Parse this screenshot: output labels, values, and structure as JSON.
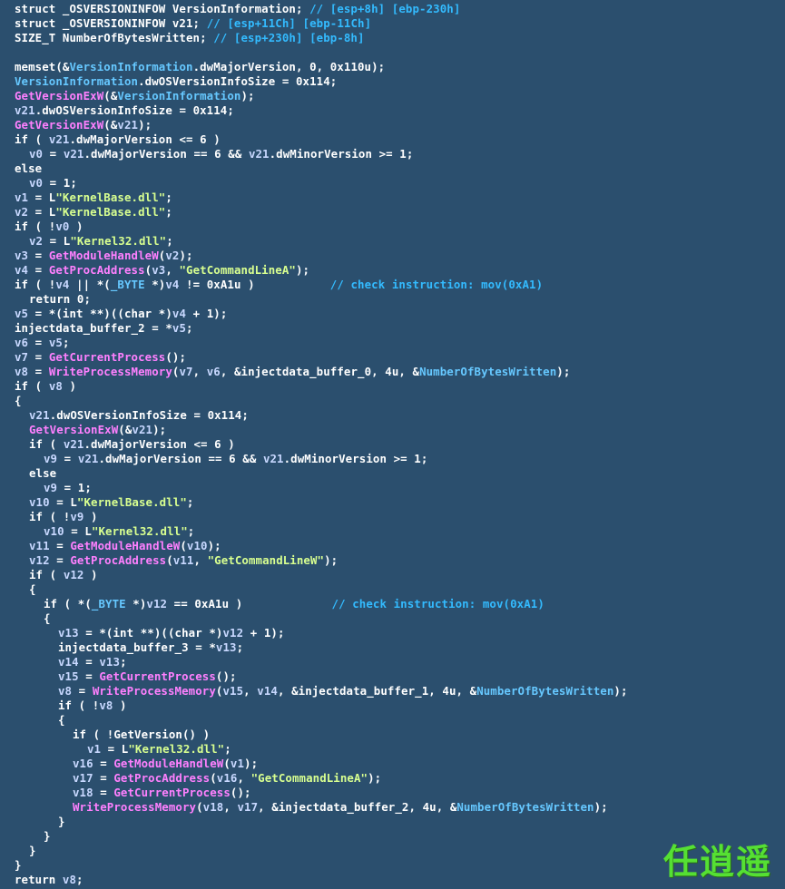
{
  "colors": {
    "background": "#2b4f6e",
    "default": "#ffffff",
    "comment": "#33bbff",
    "local_variable": "#c8d8ff",
    "global_variable": "#66c8ff",
    "function": "#ff80ff",
    "string": "#d8ff90",
    "watermark": "#55e033"
  },
  "code_lines": [
    {
      "indent": 0,
      "tokens": [
        [
          "struct _OSVERSIONINFOW VersionInformation; ",
          "d"
        ],
        [
          "// [esp+8h] [ebp-230h]",
          "c"
        ]
      ]
    },
    {
      "indent": 0,
      "tokens": [
        [
          "struct _OSVERSIONINFOW v21; ",
          "d"
        ],
        [
          "// [esp+11Ch] [ebp-11Ch]",
          "c"
        ]
      ]
    },
    {
      "indent": 0,
      "tokens": [
        [
          "SIZE_T NumberOfBytesWritten; ",
          "d"
        ],
        [
          "// [esp+230h] [ebp-8h]",
          "c"
        ]
      ]
    },
    {
      "indent": 0,
      "tokens": []
    },
    {
      "indent": 0,
      "tokens": [
        [
          "memset(&",
          "d"
        ],
        [
          "VersionInformation",
          "g"
        ],
        [
          ".dwMajorVersion, 0, 0x110u);",
          "d"
        ]
      ]
    },
    {
      "indent": 0,
      "tokens": [
        [
          "VersionInformation",
          "g"
        ],
        [
          ".dwOSVersionInfoSize = 0x114;",
          "d"
        ]
      ]
    },
    {
      "indent": 0,
      "tokens": [
        [
          "GetVersionExW",
          "f"
        ],
        [
          "(&",
          "d"
        ],
        [
          "VersionInformation",
          "g"
        ],
        [
          ");",
          "d"
        ]
      ]
    },
    {
      "indent": 0,
      "tokens": [
        [
          "v21",
          "v"
        ],
        [
          ".dwOSVersionInfoSize = 0x114;",
          "d"
        ]
      ]
    },
    {
      "indent": 0,
      "tokens": [
        [
          "GetVersionExW",
          "f"
        ],
        [
          "(&",
          "d"
        ],
        [
          "v21",
          "v"
        ],
        [
          ");",
          "d"
        ]
      ]
    },
    {
      "indent": 0,
      "tokens": [
        [
          "if ( ",
          "d"
        ],
        [
          "v21",
          "v"
        ],
        [
          ".dwMajorVersion <= 6 )",
          "d"
        ]
      ]
    },
    {
      "indent": 2,
      "tokens": [
        [
          "v0",
          "v"
        ],
        [
          " = ",
          "d"
        ],
        [
          "v21",
          "v"
        ],
        [
          ".dwMajorVersion == 6 && ",
          "d"
        ],
        [
          "v21",
          "v"
        ],
        [
          ".dwMinorVersion >= 1;",
          "d"
        ]
      ]
    },
    {
      "indent": 0,
      "tokens": [
        [
          "else",
          "d"
        ]
      ]
    },
    {
      "indent": 2,
      "tokens": [
        [
          "v0",
          "v"
        ],
        [
          " = 1;",
          "d"
        ]
      ]
    },
    {
      "indent": 0,
      "tokens": [
        [
          "v1",
          "v"
        ],
        [
          " = L",
          "d"
        ],
        [
          "\"KernelBase.dll\"",
          "s"
        ],
        [
          ";",
          "d"
        ]
      ]
    },
    {
      "indent": 0,
      "tokens": [
        [
          "v2",
          "v"
        ],
        [
          " = L",
          "d"
        ],
        [
          "\"KernelBase.dll\"",
          "s"
        ],
        [
          ";",
          "d"
        ]
      ]
    },
    {
      "indent": 0,
      "tokens": [
        [
          "if ( !",
          "d"
        ],
        [
          "v0",
          "v"
        ],
        [
          " )",
          "d"
        ]
      ]
    },
    {
      "indent": 2,
      "tokens": [
        [
          "v2",
          "v"
        ],
        [
          " = L",
          "d"
        ],
        [
          "\"Kernel32.dll\"",
          "s"
        ],
        [
          ";",
          "d"
        ]
      ]
    },
    {
      "indent": 0,
      "tokens": [
        [
          "v3",
          "v"
        ],
        [
          " = ",
          "d"
        ],
        [
          "GetModuleHandleW",
          "f"
        ],
        [
          "(",
          "d"
        ],
        [
          "v2",
          "v"
        ],
        [
          ");",
          "d"
        ]
      ]
    },
    {
      "indent": 0,
      "tokens": [
        [
          "v4",
          "v"
        ],
        [
          " = ",
          "d"
        ],
        [
          "GetProcAddress",
          "f"
        ],
        [
          "(",
          "d"
        ],
        [
          "v3",
          "v"
        ],
        [
          ", ",
          "d"
        ],
        [
          "\"GetCommandLineA\"",
          "s"
        ],
        [
          ");",
          "d"
        ]
      ]
    },
    {
      "indent": 0,
      "tokens": [
        [
          "if ( !",
          "d"
        ],
        [
          "v4",
          "v"
        ],
        [
          " || *(",
          "d"
        ],
        [
          "_BYTE",
          "g"
        ],
        [
          " *)",
          "d"
        ],
        [
          "v4",
          "v"
        ],
        [
          " != 0xA1u )           ",
          "d"
        ],
        [
          "// check instruction: mov(0xA1)",
          "c"
        ]
      ]
    },
    {
      "indent": 2,
      "tokens": [
        [
          "return 0;",
          "d"
        ]
      ]
    },
    {
      "indent": 0,
      "tokens": [
        [
          "v5",
          "v"
        ],
        [
          " = *(int **)((char *)",
          "d"
        ],
        [
          "v4",
          "v"
        ],
        [
          " + 1);",
          "d"
        ]
      ]
    },
    {
      "indent": 0,
      "tokens": [
        [
          "injectdata_buffer_2 = *",
          "d"
        ],
        [
          "v5",
          "v"
        ],
        [
          ";",
          "d"
        ]
      ]
    },
    {
      "indent": 0,
      "tokens": [
        [
          "v6",
          "v"
        ],
        [
          " = ",
          "d"
        ],
        [
          "v5",
          "v"
        ],
        [
          ";",
          "d"
        ]
      ]
    },
    {
      "indent": 0,
      "tokens": [
        [
          "v7",
          "v"
        ],
        [
          " = ",
          "d"
        ],
        [
          "GetCurrentProcess",
          "f"
        ],
        [
          "();",
          "d"
        ]
      ]
    },
    {
      "indent": 0,
      "tokens": [
        [
          "v8",
          "v"
        ],
        [
          " = ",
          "d"
        ],
        [
          "WriteProcessMemory",
          "f"
        ],
        [
          "(",
          "d"
        ],
        [
          "v7",
          "v"
        ],
        [
          ", ",
          "d"
        ],
        [
          "v6",
          "v"
        ],
        [
          ", &injectdata_buffer_0, 4u, &",
          "d"
        ],
        [
          "NumberOfBytesWritten",
          "g"
        ],
        [
          ");",
          "d"
        ]
      ]
    },
    {
      "indent": 0,
      "tokens": [
        [
          "if ( ",
          "d"
        ],
        [
          "v8",
          "v"
        ],
        [
          " )",
          "d"
        ]
      ]
    },
    {
      "indent": 0,
      "tokens": [
        [
          "{",
          "d"
        ]
      ]
    },
    {
      "indent": 2,
      "tokens": [
        [
          "v21",
          "v"
        ],
        [
          ".dwOSVersionInfoSize = 0x114;",
          "d"
        ]
      ]
    },
    {
      "indent": 2,
      "tokens": [
        [
          "GetVersionExW",
          "f"
        ],
        [
          "(&",
          "d"
        ],
        [
          "v21",
          "v"
        ],
        [
          ");",
          "d"
        ]
      ]
    },
    {
      "indent": 2,
      "tokens": [
        [
          "if ( ",
          "d"
        ],
        [
          "v21",
          "v"
        ],
        [
          ".dwMajorVersion <= 6 )",
          "d"
        ]
      ]
    },
    {
      "indent": 4,
      "tokens": [
        [
          "v9",
          "v"
        ],
        [
          " = ",
          "d"
        ],
        [
          "v21",
          "v"
        ],
        [
          ".dwMajorVersion == 6 && ",
          "d"
        ],
        [
          "v21",
          "v"
        ],
        [
          ".dwMinorVersion >= 1;",
          "d"
        ]
      ]
    },
    {
      "indent": 2,
      "tokens": [
        [
          "else",
          "d"
        ]
      ]
    },
    {
      "indent": 4,
      "tokens": [
        [
          "v9",
          "v"
        ],
        [
          " = 1;",
          "d"
        ]
      ]
    },
    {
      "indent": 2,
      "tokens": [
        [
          "v10",
          "v"
        ],
        [
          " = L",
          "d"
        ],
        [
          "\"KernelBase.dll\"",
          "s"
        ],
        [
          ";",
          "d"
        ]
      ]
    },
    {
      "indent": 2,
      "tokens": [
        [
          "if ( !",
          "d"
        ],
        [
          "v9",
          "v"
        ],
        [
          " )",
          "d"
        ]
      ]
    },
    {
      "indent": 4,
      "tokens": [
        [
          "v10",
          "v"
        ],
        [
          " = L",
          "d"
        ],
        [
          "\"Kernel32.dll\"",
          "s"
        ],
        [
          ";",
          "d"
        ]
      ]
    },
    {
      "indent": 2,
      "tokens": [
        [
          "v11",
          "v"
        ],
        [
          " = ",
          "d"
        ],
        [
          "GetModuleHandleW",
          "f"
        ],
        [
          "(",
          "d"
        ],
        [
          "v10",
          "v"
        ],
        [
          ");",
          "d"
        ]
      ]
    },
    {
      "indent": 2,
      "tokens": [
        [
          "v12",
          "v"
        ],
        [
          " = ",
          "d"
        ],
        [
          "GetProcAddress",
          "f"
        ],
        [
          "(",
          "d"
        ],
        [
          "v11",
          "v"
        ],
        [
          ", ",
          "d"
        ],
        [
          "\"GetCommandLineW\"",
          "s"
        ],
        [
          ");",
          "d"
        ]
      ]
    },
    {
      "indent": 2,
      "tokens": [
        [
          "if ( ",
          "d"
        ],
        [
          "v12",
          "v"
        ],
        [
          " )",
          "d"
        ]
      ]
    },
    {
      "indent": 2,
      "tokens": [
        [
          "{",
          "d"
        ]
      ]
    },
    {
      "indent": 4,
      "tokens": [
        [
          "if ( *(",
          "d"
        ],
        [
          "_BYTE",
          "g"
        ],
        [
          " *)",
          "d"
        ],
        [
          "v12",
          "v"
        ],
        [
          " == 0xA1u )             ",
          "d"
        ],
        [
          "// check instruction: mov(0xA1)",
          "c"
        ]
      ]
    },
    {
      "indent": 4,
      "tokens": [
        [
          "{",
          "d"
        ]
      ]
    },
    {
      "indent": 6,
      "tokens": [
        [
          "v13",
          "v"
        ],
        [
          " = *(int **)((char *)",
          "d"
        ],
        [
          "v12",
          "v"
        ],
        [
          " + 1);",
          "d"
        ]
      ]
    },
    {
      "indent": 6,
      "tokens": [
        [
          "injectdata_buffer_3 = *",
          "d"
        ],
        [
          "v13",
          "v"
        ],
        [
          ";",
          "d"
        ]
      ]
    },
    {
      "indent": 6,
      "tokens": [
        [
          "v14",
          "v"
        ],
        [
          " = ",
          "d"
        ],
        [
          "v13",
          "v"
        ],
        [
          ";",
          "d"
        ]
      ]
    },
    {
      "indent": 6,
      "tokens": [
        [
          "v15",
          "v"
        ],
        [
          " = ",
          "d"
        ],
        [
          "GetCurrentProcess",
          "f"
        ],
        [
          "();",
          "d"
        ]
      ]
    },
    {
      "indent": 6,
      "tokens": [
        [
          "v8",
          "v"
        ],
        [
          " = ",
          "d"
        ],
        [
          "WriteProcessMemory",
          "f"
        ],
        [
          "(",
          "d"
        ],
        [
          "v15",
          "v"
        ],
        [
          ", ",
          "d"
        ],
        [
          "v14",
          "v"
        ],
        [
          ", &injectdata_buffer_1, 4u, &",
          "d"
        ],
        [
          "NumberOfBytesWritten",
          "g"
        ],
        [
          ");",
          "d"
        ]
      ]
    },
    {
      "indent": 6,
      "tokens": [
        [
          "if ( !",
          "d"
        ],
        [
          "v8",
          "v"
        ],
        [
          " )",
          "d"
        ]
      ]
    },
    {
      "indent": 6,
      "tokens": [
        [
          "{",
          "d"
        ]
      ]
    },
    {
      "indent": 8,
      "tokens": [
        [
          "if ( !GetVersion() )",
          "d"
        ]
      ]
    },
    {
      "indent": 10,
      "tokens": [
        [
          "v1",
          "v"
        ],
        [
          " = L",
          "d"
        ],
        [
          "\"Kernel32.dll\"",
          "s"
        ],
        [
          ";",
          "d"
        ]
      ]
    },
    {
      "indent": 8,
      "tokens": [
        [
          "v16",
          "v"
        ],
        [
          " = ",
          "d"
        ],
        [
          "GetModuleHandleW",
          "f"
        ],
        [
          "(",
          "d"
        ],
        [
          "v1",
          "v"
        ],
        [
          ");",
          "d"
        ]
      ]
    },
    {
      "indent": 8,
      "tokens": [
        [
          "v17",
          "v"
        ],
        [
          " = ",
          "d"
        ],
        [
          "GetProcAddress",
          "f"
        ],
        [
          "(",
          "d"
        ],
        [
          "v16",
          "v"
        ],
        [
          ", ",
          "d"
        ],
        [
          "\"GetCommandLineA\"",
          "s"
        ],
        [
          ");",
          "d"
        ]
      ]
    },
    {
      "indent": 8,
      "tokens": [
        [
          "v18",
          "v"
        ],
        [
          " = ",
          "d"
        ],
        [
          "GetCurrentProcess",
          "f"
        ],
        [
          "();",
          "d"
        ]
      ]
    },
    {
      "indent": 8,
      "tokens": [
        [
          "WriteProcessMemory",
          "f"
        ],
        [
          "(",
          "d"
        ],
        [
          "v18",
          "v"
        ],
        [
          ", ",
          "d"
        ],
        [
          "v17",
          "v"
        ],
        [
          ", &injectdata_buffer_2, 4u, &",
          "d"
        ],
        [
          "NumberOfBytesWritten",
          "g"
        ],
        [
          ");",
          "d"
        ]
      ]
    },
    {
      "indent": 6,
      "tokens": [
        [
          "}",
          "d"
        ]
      ]
    },
    {
      "indent": 4,
      "tokens": [
        [
          "}",
          "d"
        ]
      ]
    },
    {
      "indent": 2,
      "tokens": [
        [
          "}",
          "d"
        ]
      ]
    },
    {
      "indent": 0,
      "tokens": [
        [
          "}",
          "d"
        ]
      ]
    },
    {
      "indent": 0,
      "tokens": [
        [
          "return ",
          "d"
        ],
        [
          "v8",
          "v"
        ],
        [
          ";",
          "d"
        ]
      ]
    }
  ],
  "watermark": "任逍遥"
}
